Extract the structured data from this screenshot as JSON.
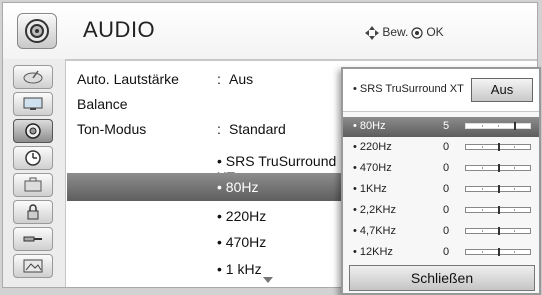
{
  "header": {
    "title": "AUDIO",
    "icon": "speaker-icon",
    "hint_move": "Bew.",
    "hint_ok": "OK"
  },
  "rail": [
    {
      "icon": "satellite-dish-icon",
      "selected": false
    },
    {
      "icon": "monitor-icon",
      "selected": false
    },
    {
      "icon": "speaker-icon",
      "selected": true
    },
    {
      "icon": "clock-icon",
      "selected": false
    },
    {
      "icon": "briefcase-icon",
      "selected": false
    },
    {
      "icon": "lock-icon",
      "selected": false
    },
    {
      "icon": "input-cable-icon",
      "selected": false
    },
    {
      "icon": "photo-icon",
      "selected": false
    }
  ],
  "menu": {
    "items": [
      {
        "label": "Auto. Lautstärke",
        "value": "Aus"
      },
      {
        "label": "Balance",
        "value": ""
      },
      {
        "label": "Ton-Modus",
        "value": "Standard"
      }
    ],
    "sub_items": [
      {
        "label": "• SRS TruSurround XT :"
      },
      {
        "label": "• 80Hz"
      },
      {
        "label": "• 220Hz"
      },
      {
        "label": "• 470Hz"
      },
      {
        "label": "• 1 kHz"
      }
    ]
  },
  "panel": {
    "srs_label": "• SRS TruSurround XT",
    "srs_value": "Aus",
    "bands": [
      {
        "label": "• 80Hz",
        "value": "5",
        "level": 5
      },
      {
        "label": "• 220Hz",
        "value": "0",
        "level": 0
      },
      {
        "label": "• 470Hz",
        "value": "0",
        "level": 0
      },
      {
        "label": "• 1KHz",
        "value": "0",
        "level": 0
      },
      {
        "label": "• 2,2KHz",
        "value": "0",
        "level": 0
      },
      {
        "label": "• 4,7KHz",
        "value": "0",
        "level": 0
      },
      {
        "label": "• 12KHz",
        "value": "0",
        "level": 0
      }
    ],
    "level_range": [
      -10,
      10
    ],
    "close_label": "Schließen"
  },
  "colors": {
    "highlight": "#6e6e6e",
    "background": "#ffffff",
    "rail": "#ececec"
  }
}
